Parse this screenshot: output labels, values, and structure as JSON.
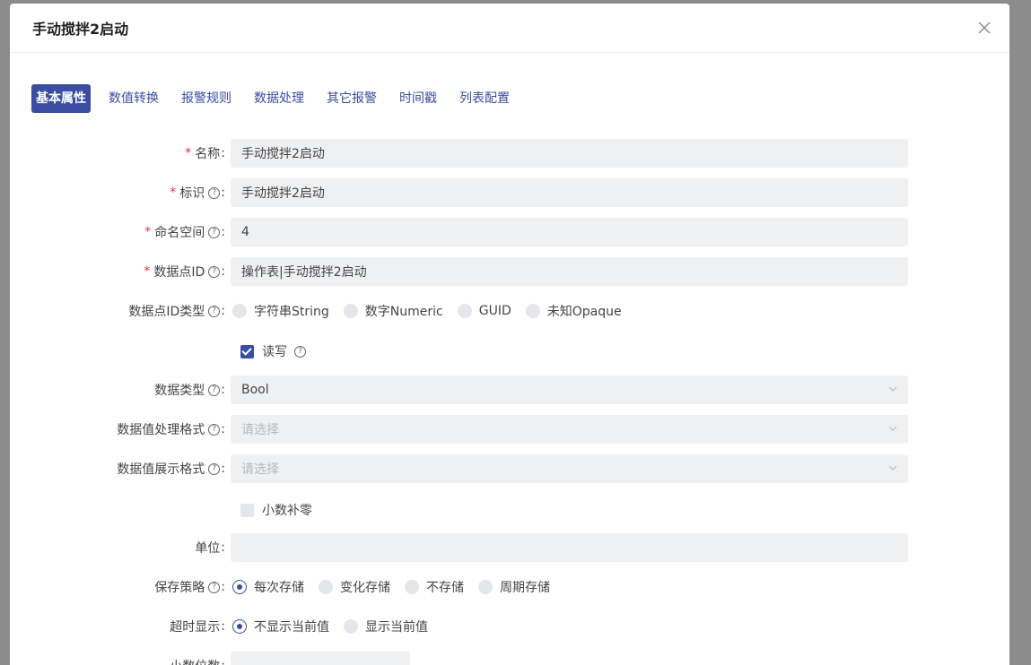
{
  "modal": {
    "title": "手动搅拌2启动"
  },
  "tabs": [
    {
      "label": "基本属性",
      "active": true
    },
    {
      "label": "数值转换"
    },
    {
      "label": "报警规则"
    },
    {
      "label": "数据处理"
    },
    {
      "label": "其它报警"
    },
    {
      "label": "时间戳"
    },
    {
      "label": "列表配置"
    }
  ],
  "form": {
    "name": {
      "label": "名称",
      "value": "手动搅拌2启动"
    },
    "identifier": {
      "label": "标识",
      "value": "手动搅拌2启动"
    },
    "namespace": {
      "label": "命名空间",
      "value": "4"
    },
    "point_id": {
      "label": "数据点ID",
      "value": "操作表|手动搅拌2启动"
    },
    "point_id_type": {
      "label": "数据点ID类型",
      "options": [
        "字符串String",
        "数字Numeric",
        "GUID",
        "未知Opaque"
      ]
    },
    "readwrite": {
      "label": "读写",
      "checked": true
    },
    "data_type": {
      "label": "数据类型",
      "value": "Bool"
    },
    "value_process_format": {
      "label": "数据值处理格式",
      "placeholder": "请选择"
    },
    "value_display_format": {
      "label": "数据值展示格式",
      "placeholder": "请选择"
    },
    "decimal_pad": {
      "label": "小数补零",
      "checked": false
    },
    "unit": {
      "label": "单位",
      "value": ""
    },
    "save_policy": {
      "label": "保存策略",
      "options": [
        "每次存储",
        "变化存储",
        "不存储",
        "周期存储"
      ],
      "selected": 0
    },
    "timeout_display": {
      "label": "超时显示",
      "options": [
        "不显示当前值",
        "显示当前值"
      ],
      "selected": 0
    },
    "decimal_places": {
      "label": "小数位数"
    }
  },
  "colors": {
    "accent": "#3a4da0",
    "required": "#e03636",
    "field_bg": "#eff0f2"
  }
}
